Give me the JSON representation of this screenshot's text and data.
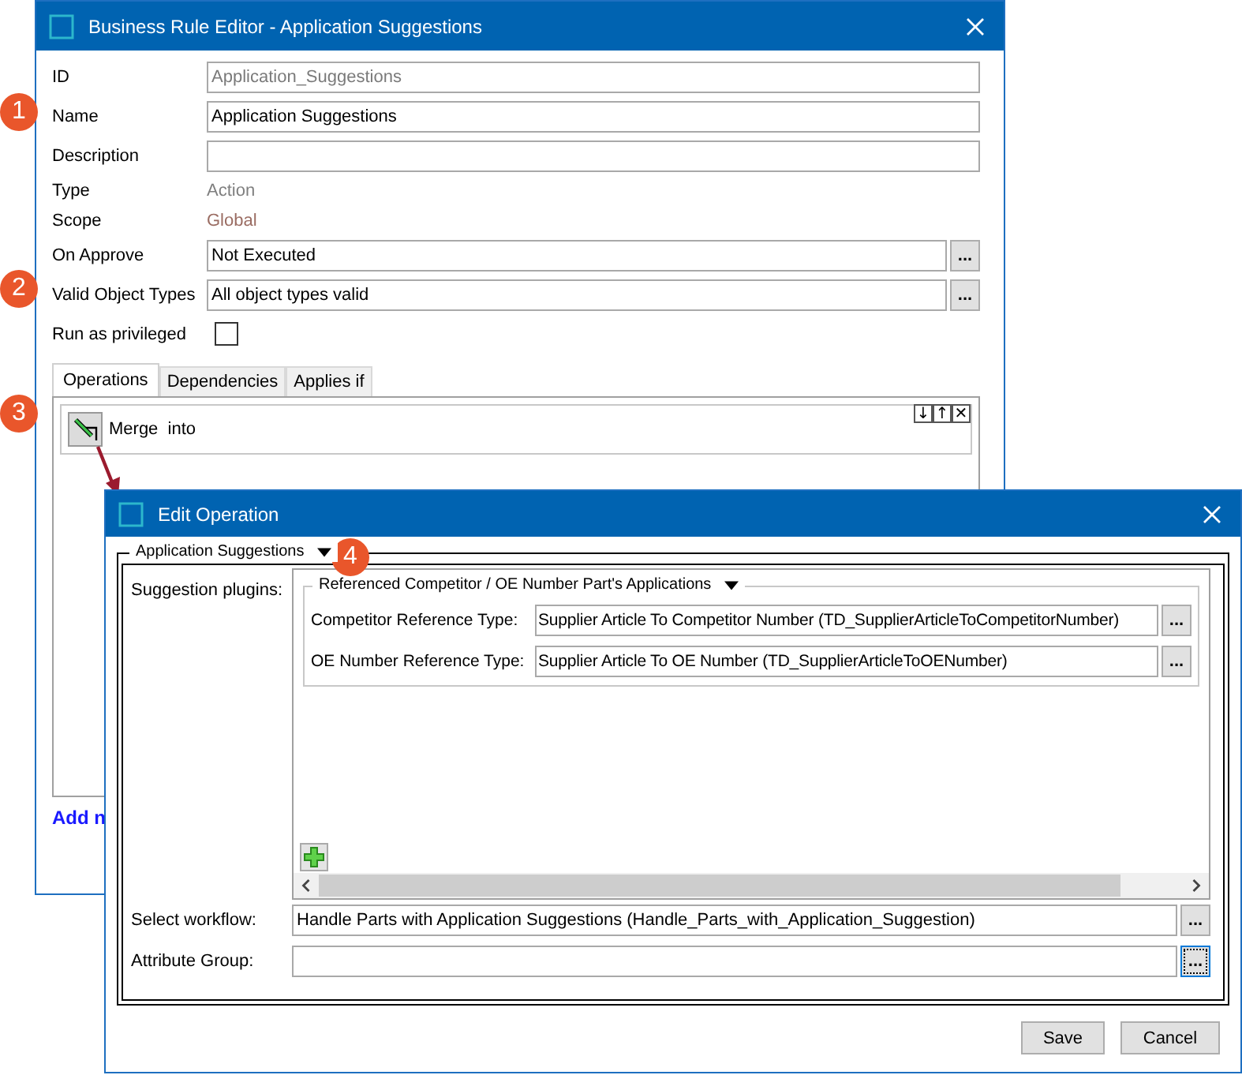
{
  "business_rule_editor": {
    "title": "Business Rule Editor - Application Suggestions",
    "fields": [
      {
        "label": "ID",
        "kind": "readonly",
        "value": "Application_Suggestions"
      },
      {
        "label": "Name",
        "kind": "input",
        "value": "Application Suggestions"
      },
      {
        "label": "Description",
        "kind": "input"
      },
      {
        "label": "Type",
        "kind": "text",
        "value": "Action"
      },
      {
        "label": "Scope",
        "kind": "text",
        "value": "Global"
      },
      {
        "label": "On Approve",
        "kind": "picker",
        "value": "Not Executed",
        "button": "..."
      },
      {
        "label": "Valid Object Types",
        "kind": "picker",
        "value": "All object types valid",
        "button": "..."
      },
      {
        "label": "Run as privileged",
        "kind": "checkbox",
        "checked": false
      }
    ],
    "tabs": [
      {
        "label": "Operations",
        "selected": true
      },
      {
        "label": "Dependencies",
        "selected": false
      },
      {
        "label": "Applies if",
        "selected": false
      }
    ],
    "operations": [
      {
        "label": "Merge  into"
      }
    ],
    "operation_controls": [
      "↓",
      "↑",
      "✕"
    ],
    "add_link": "Add n"
  },
  "callouts": [
    "1",
    "2",
    "3",
    "4"
  ],
  "edit_operation": {
    "title": "Edit Operation",
    "group": {
      "legend": "Application Suggestions",
      "expanded": true,
      "plugins_label": "Suggestion plugins:",
      "plugin": {
        "legend": "Referenced Competitor / OE Number Part's Applications",
        "expanded": true,
        "rows": [
          {
            "label": "Competitor Reference Type:",
            "value": "Supplier Article To Competitor Number (TD_SupplierArticleToCompetitorNumber)",
            "button": "...",
            "focused": false
          },
          {
            "label": "OE Number Reference Type:",
            "value": "Supplier Article To OE Number (TD_SupplierArticleToOENumber)",
            "button": "...",
            "focused": false
          }
        ]
      },
      "rows": [
        {
          "label": "Select workflow:",
          "value": "Handle Parts with Application Suggestions (Handle_Parts_with_Application_Suggestion)",
          "button": "...",
          "focused": false
        },
        {
          "label": "Attribute Group:",
          "value": "",
          "button": "...",
          "focused": true
        }
      ]
    },
    "buttons": [
      "Save",
      "Cancel"
    ]
  }
}
